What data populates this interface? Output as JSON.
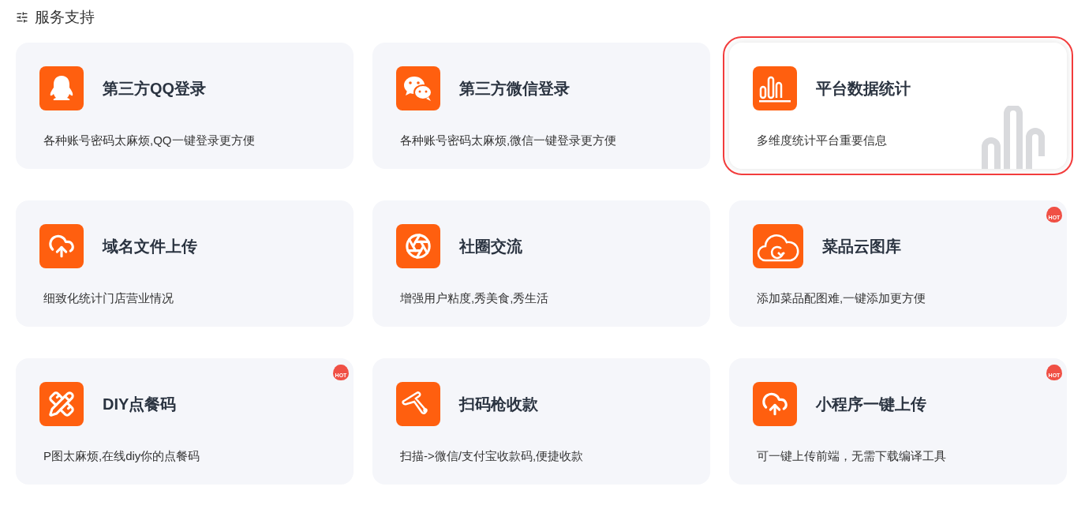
{
  "section": {
    "title": "服务支持"
  },
  "cards": [
    {
      "kind": "qq",
      "title": "第三方QQ登录",
      "description": "各种账号密码太麻烦,QQ一键登录更方便",
      "selected": false
    },
    {
      "kind": "wechat",
      "title": "第三方微信登录",
      "description": "各种账号密码太麻烦,微信一键登录更方便",
      "selected": false
    },
    {
      "kind": "chart",
      "title": "平台数据统计",
      "description": "多维度统计平台重要信息",
      "selected": true
    },
    {
      "kind": "upload",
      "title": "域名文件上传",
      "description": "细致化统计门店营业情况",
      "selected": false
    },
    {
      "kind": "aperture",
      "title": "社圈交流",
      "description": "增强用户粘度,秀美食,秀生活",
      "selected": false
    },
    {
      "kind": "cloud",
      "title": "菜品云图库",
      "description": "添加菜品配图难,一键添加更方便",
      "selected": false,
      "badge": "HOT"
    },
    {
      "kind": "tools",
      "title": "DIY点餐码",
      "description": "P图太麻烦,在线diy你的点餐码",
      "selected": false,
      "badge": "HOT"
    },
    {
      "kind": "scanner",
      "title": "扫码枪收款",
      "description": "扫描->微信/支付宝收款码,便捷收款",
      "selected": false
    },
    {
      "kind": "upload",
      "title": "小程序一键上传",
      "description": "可一键上传前端，无需下载编译工具",
      "selected": false,
      "badge": "HOT"
    }
  ]
}
